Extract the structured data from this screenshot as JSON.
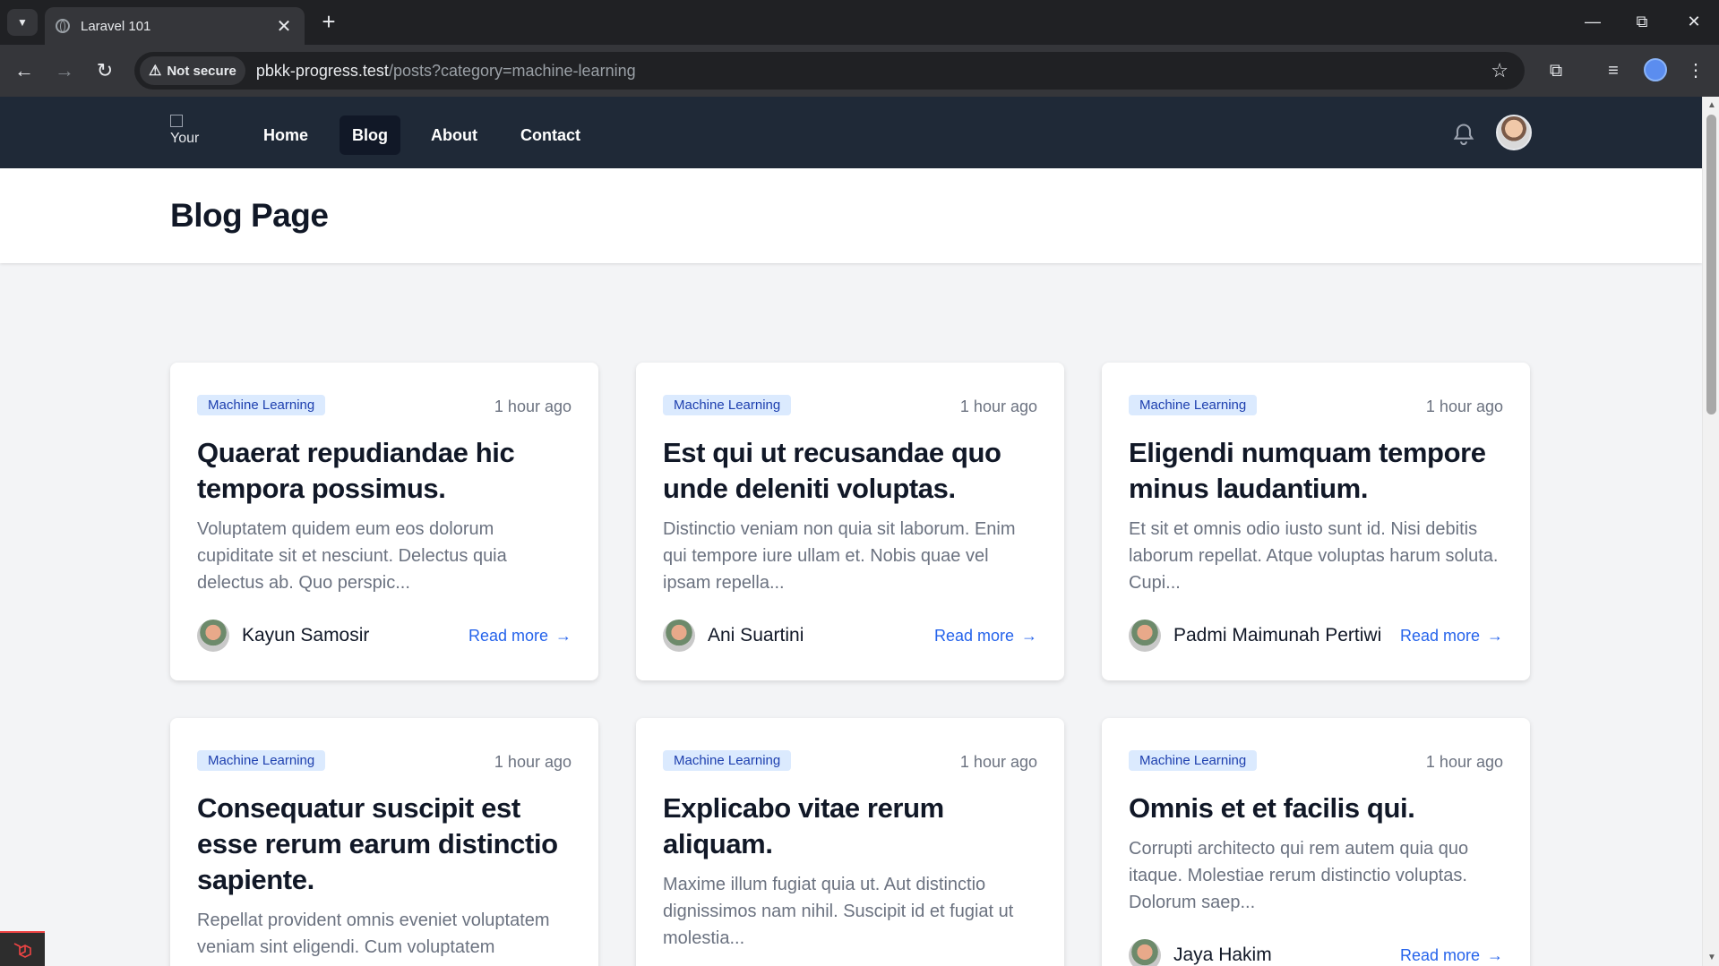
{
  "browser": {
    "tab_title": "Laravel 101",
    "security_label": "Not secure",
    "url_host": "pbkk-progress.test",
    "url_path": "/posts?category=machine-learning"
  },
  "nav": {
    "logo_alt": "Your",
    "links": [
      "Home",
      "Blog",
      "About",
      "Contact"
    ],
    "active": "Blog"
  },
  "header": {
    "title": "Blog Page"
  },
  "posts": [
    {
      "category": "Machine Learning",
      "time": "1 hour ago",
      "title": "Quaerat repudiandae hic tempora possimus.",
      "excerpt": "Voluptatem quidem eum eos dolorum cupiditate sit et nesciunt. Delectus quia delectus ab. Quo perspic...",
      "author": "Kayun Samosir",
      "read_more": "Read more"
    },
    {
      "category": "Machine Learning",
      "time": "1 hour ago",
      "title": "Est qui ut recusandae quo unde deleniti voluptas.",
      "excerpt": "Distinctio veniam non quia sit laborum. Enim qui tempore iure ullam et. Nobis quae vel ipsam repella...",
      "author": "Ani Suartini",
      "read_more": "Read more"
    },
    {
      "category": "Machine Learning",
      "time": "1 hour ago",
      "title": "Eligendi numquam tempore minus laudantium.",
      "excerpt": "Et sit et omnis odio iusto sunt id. Nisi debitis laborum repellat. Atque voluptas harum soluta. Cupi...",
      "author": "Padmi Maimunah Pertiwi",
      "read_more": "Read more"
    },
    {
      "category": "Machine Learning",
      "time": "1 hour ago",
      "title": "Consequatur suscipit est esse rerum earum distinctio sapiente.",
      "excerpt": "Repellat provident omnis eveniet voluptatem veniam sint eligendi. Cum voluptatem",
      "author": "",
      "read_more": ""
    },
    {
      "category": "Machine Learning",
      "time": "1 hour ago",
      "title": "Explicabo vitae rerum aliquam.",
      "excerpt": "Maxime illum fugiat quia ut. Aut distinctio dignissimos nam nihil. Suscipit id et fugiat ut molestia...",
      "author": "",
      "read_more": ""
    },
    {
      "category": "Machine Learning",
      "time": "1 hour ago",
      "title": "Omnis et et facilis qui.",
      "excerpt": "Corrupti architecto qui rem autem quia quo itaque. Molestiae rerum distinctio voluptas. Dolorum saep...",
      "author": "Jaya Hakim",
      "read_more": "Read more"
    }
  ],
  "colors": {
    "nav_bg": "#1f2937",
    "badge_bg": "#dbeafe",
    "badge_text": "#1e40af",
    "link": "#2563eb"
  }
}
